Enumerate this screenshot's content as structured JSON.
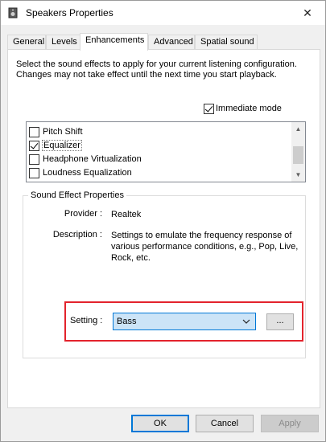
{
  "window": {
    "title": "Speakers Properties",
    "close_glyph": "✕"
  },
  "tabs": [
    {
      "label": "General"
    },
    {
      "label": "Levels"
    },
    {
      "label": "Enhancements",
      "active": true
    },
    {
      "label": "Advanced"
    },
    {
      "label": "Spatial sound"
    }
  ],
  "enhancements": {
    "description": "Select the sound effects to apply for your current listening configuration. Changes may not take effect until the next time you start playback.",
    "immediate_mode": {
      "label": "Immediate mode",
      "checked": true
    },
    "effects": [
      {
        "label": "Pitch Shift",
        "checked": false
      },
      {
        "label": "Equalizer",
        "checked": true
      },
      {
        "label": "Headphone Virtualization",
        "checked": false
      },
      {
        "label": "Loudness Equalization",
        "checked": false
      }
    ]
  },
  "sound_effect_properties": {
    "title": "Sound Effect Properties",
    "provider_label": "Provider :",
    "provider_value": "Realtek",
    "description_label": "Description :",
    "description_value": "Settings to emulate the frequency response of various performance conditions,  e.g., Pop, Live, Rock, etc.",
    "setting_label": "Setting :",
    "setting_value": "Bass",
    "more_button_label": "..."
  },
  "buttons": {
    "ok": "OK",
    "cancel": "Cancel",
    "apply": "Apply"
  },
  "colors": {
    "highlight_border": "#e3232c",
    "combo_selected": "#cce4f7",
    "accent": "#0078d7"
  }
}
